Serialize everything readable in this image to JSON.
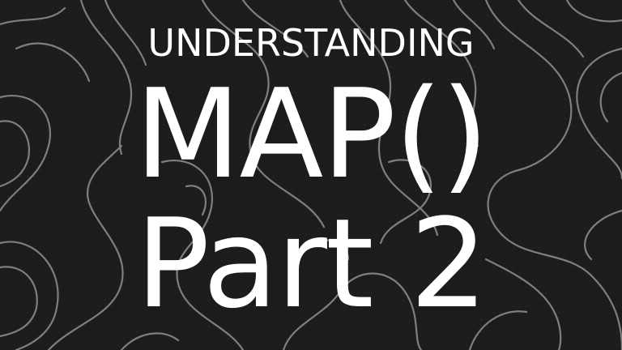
{
  "background": {
    "pattern": "topographic-contour-lines",
    "base_color": "#1c1c1c",
    "line_color": "#8a8a8a"
  },
  "title": {
    "line1": "UNDERSTANDING",
    "line2": "MAP()",
    "line3": "Part 2",
    "color": "#ffffff"
  }
}
